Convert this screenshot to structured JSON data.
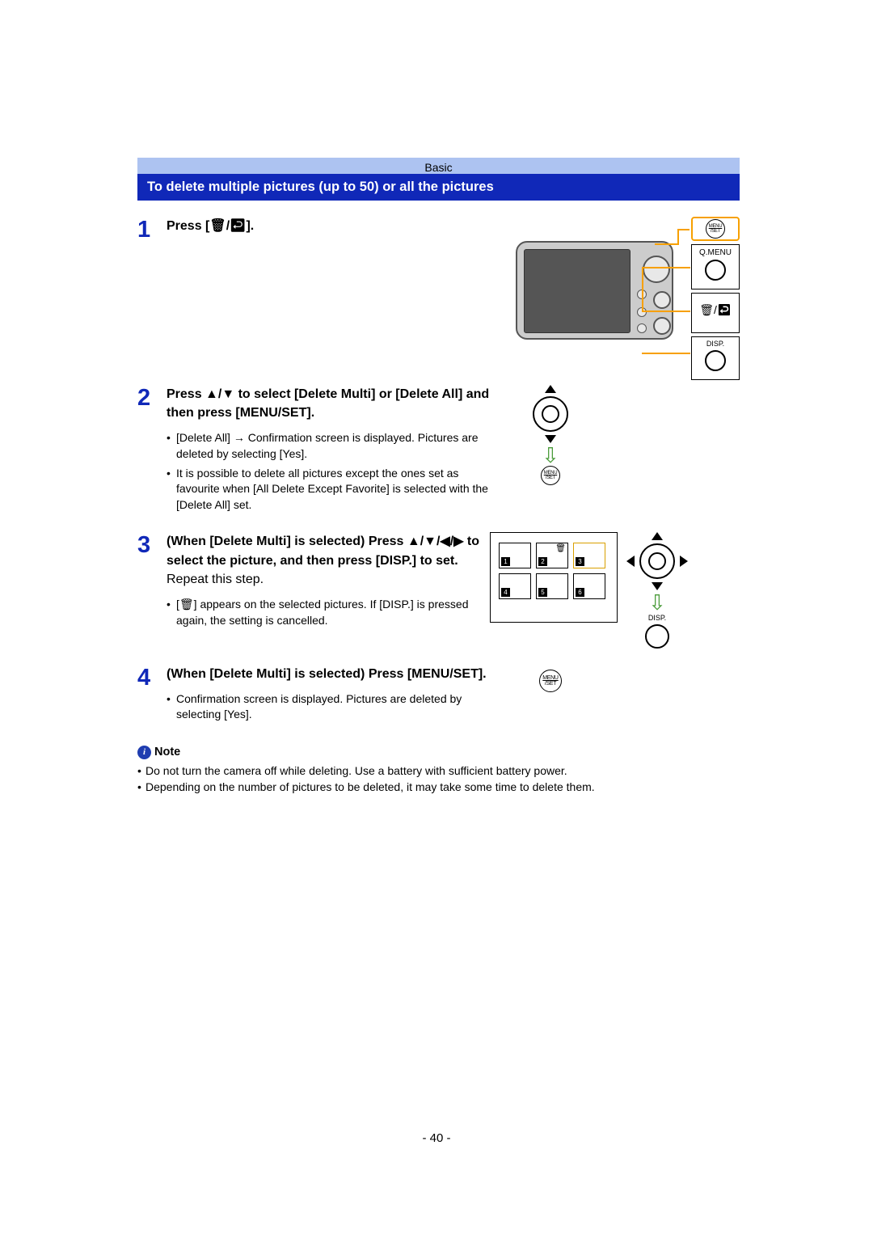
{
  "header": {
    "category": "Basic"
  },
  "title": "To delete multiple pictures (up to 50) or all the pictures",
  "steps": {
    "s1": {
      "num": "1",
      "head_before": "Press [",
      "head_icon": "🗑/↩",
      "head_after": "]."
    },
    "s2": {
      "num": "2",
      "head": "Press ▲/▼ to select [Delete Multi] or [Delete All] and then press [MENU/SET].",
      "b1": "[Delete All] → Confirmation screen is displayed. Pictures are deleted by selecting [Yes].",
      "b2": "It is possible to delete all pictures except the ones set as favourite when [All Delete Except Favorite] is selected with the [Delete All] set."
    },
    "s3": {
      "num": "3",
      "head_bold": "(When [Delete Multi] is selected) Press ▲/▼/◀/▶ to select the picture, and then press [DISP.] to set.",
      "head_norm": " Repeat this step.",
      "b1": "[🗑] appears on the selected pictures. If [DISP.] is pressed again, the setting is cancelled."
    },
    "s4": {
      "num": "4",
      "head": "(When [Delete Multi] is selected) Press [MENU/SET].",
      "b1": "Confirmation screen is displayed. Pictures are deleted by selecting [Yes]."
    }
  },
  "callouts": {
    "menu_set_top": "MENU",
    "menu_set_bot": "/SET",
    "qmenu": "Q.MENU",
    "delete_return": "🗑/↩",
    "disp": "DISP."
  },
  "thumbs": [
    "1",
    "2",
    "3",
    "4",
    "5",
    "6"
  ],
  "note": {
    "label": "Note",
    "n1": "Do not turn the camera off while deleting. Use a battery with sufficient battery power.",
    "n2": "Depending on the number of pictures to be deleted, it may take some time to delete them."
  },
  "page": "- 40 -"
}
